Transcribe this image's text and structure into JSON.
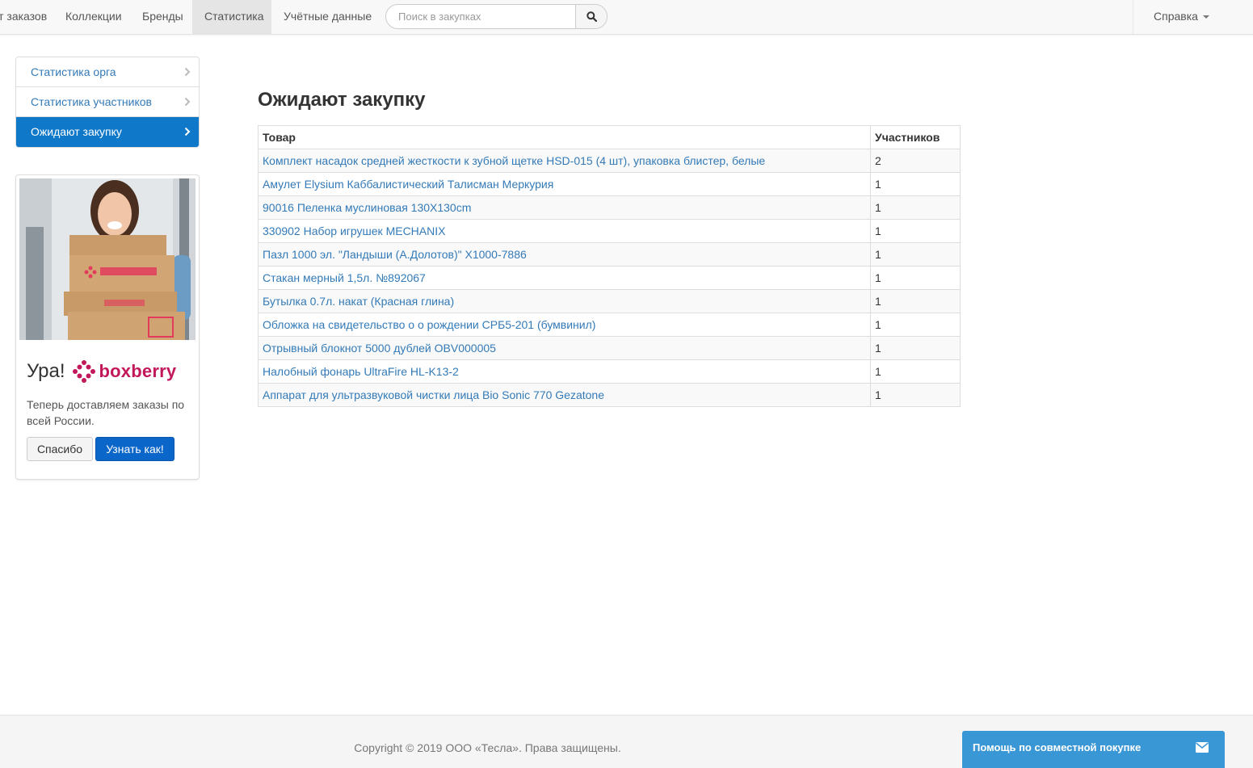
{
  "nav": {
    "items": [
      {
        "label": "Ждут заказов"
      },
      {
        "label": "Коллекции"
      },
      {
        "label": "Бренды"
      },
      {
        "label": "Статистика"
      },
      {
        "label": "Учётные данные"
      }
    ],
    "search_placeholder": "Поиск в закупках",
    "help_label": "Справка"
  },
  "sidebar": {
    "items": [
      {
        "label": "Статистика орга"
      },
      {
        "label": "Статистика участников"
      },
      {
        "label": "Ожидают закупку"
      }
    ]
  },
  "promo": {
    "headline": "Ура!",
    "brand": "boxberry",
    "text": "Теперь доставляем заказы по всей России.",
    "thanks_label": "Спасибо",
    "learn_label": "Узнать как!"
  },
  "main": {
    "title": "Ожидают закупку",
    "columns": [
      "Товар",
      "Участников"
    ],
    "rows": [
      {
        "name": "Комплект насадок средней жесткости к зубной щетке HSD-015 (4 шт), упаковка блистер, белые",
        "count": "2"
      },
      {
        "name": "Амулет Elysium Каббалистический Талисман Меркурия",
        "count": "1"
      },
      {
        "name": "90016 Пеленка муслиновая 130Х130cm",
        "count": "1"
      },
      {
        "name": "330902 Набор игрушек MECHANIX",
        "count": "1"
      },
      {
        "name": "Пазл 1000 эл. \"Ландыши (А.Долотов)\" Х1000-7886",
        "count": "1"
      },
      {
        "name": "Стакан мерный 1,5л. №892067",
        "count": "1"
      },
      {
        "name": "Бутылка 0.7л. накат (Красная глина)",
        "count": "1"
      },
      {
        "name": "Обложка на свидетельство о о рождении СРБ5-201 (бумвинил)",
        "count": "1"
      },
      {
        "name": "Отрывный блокнот 5000 дублей OBV000005",
        "count": "1"
      },
      {
        "name": "Налобный фонарь UltraFire HL-K13-2",
        "count": "1"
      },
      {
        "name": "Аппарат для ультразвуковой чистки лица Bio Sonic 770 Gezatone",
        "count": "1"
      }
    ]
  },
  "footer": {
    "copyright": "Copyright © 2019 ООО «Тесла». Права защищены."
  },
  "help_widget": {
    "label": "Помощь по совместной покупке"
  }
}
